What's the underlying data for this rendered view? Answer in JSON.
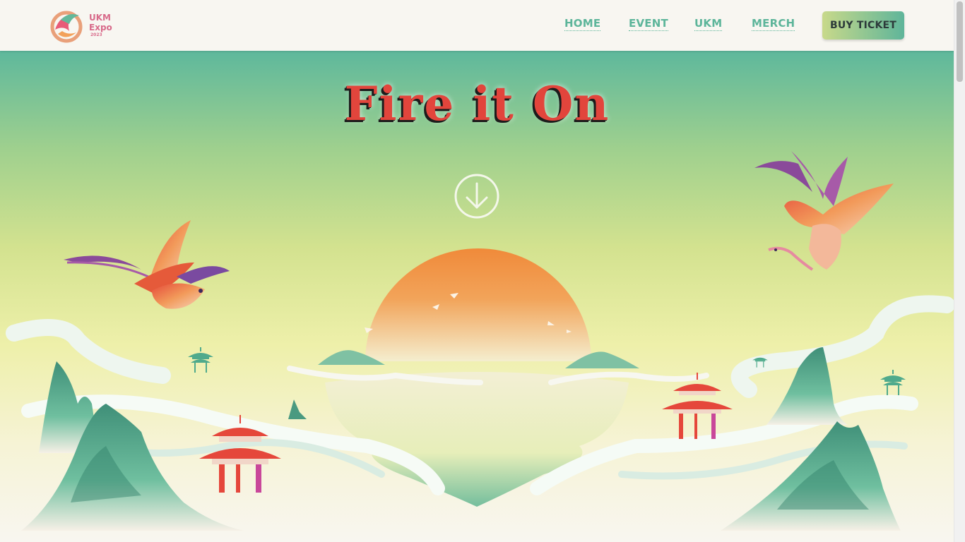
{
  "header": {
    "logo": {
      "line1": "UKM",
      "line2": "Expo",
      "year": "2023"
    },
    "nav": [
      {
        "label": "HOME"
      },
      {
        "label": "EVENT"
      },
      {
        "label": "UKM"
      },
      {
        "label": "MERCH"
      }
    ],
    "cta_label": "BUY TICKET"
  },
  "hero": {
    "title": "Fire it On",
    "scroll_icon": "arrow-down-circle-icon"
  },
  "colors": {
    "accent": "#5db59a",
    "title": "#e2453c",
    "sun": "#f08a3a",
    "logo": "#d86a8a"
  }
}
